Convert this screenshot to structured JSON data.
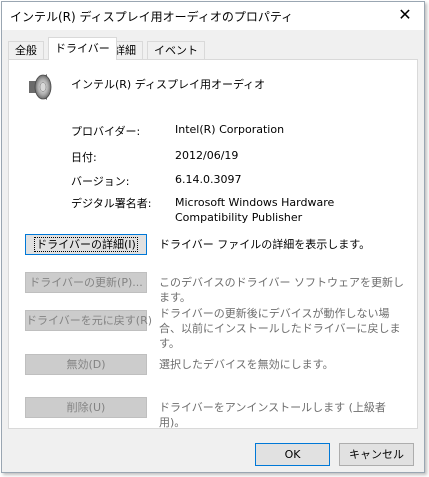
{
  "window": {
    "title": "インテル(R) ディスプレイ用オーディオのプロパティ"
  },
  "tabs": [
    "全般",
    "ドライバー",
    "詳細",
    "イベント"
  ],
  "device": {
    "name": "インテル(R) ディスプレイ用オーディオ",
    "icon": "speaker-icon"
  },
  "info": [
    {
      "label": "プロバイダー:",
      "value": "Intel(R) Corporation"
    },
    {
      "label": "日付:",
      "value": "2012/06/19"
    },
    {
      "label": "バージョン:",
      "value": "6.14.0.3097"
    },
    {
      "label": "デジタル署名者:",
      "value": "Microsoft Windows Hardware Compatibility Publisher"
    }
  ],
  "actions": [
    {
      "button": "ドライバーの詳細(I)",
      "description": "ドライバー ファイルの詳細を表示します。",
      "enabled": true
    },
    {
      "button": "ドライバーの更新(P)...",
      "description": "このデバイスのドライバー ソフトウェアを更新します。",
      "enabled": false
    },
    {
      "button": "ドライバーを元に戻す(R)",
      "description": "ドライバーの更新後にデバイスが動作しない場合、以前にインストールしたドライバーに戻します。",
      "enabled": false
    },
    {
      "button": "無効(D)",
      "description": "選択したデバイスを無効にします。",
      "enabled": false
    },
    {
      "button": "削除(U)",
      "description": "ドライバーをアンインストールします (上級者用)。",
      "enabled": false
    }
  ],
  "footer": {
    "ok": "OK",
    "cancel": "キャンセル"
  },
  "colors": {
    "accent": "#0078d7",
    "dialog_bg": "#f0f0f0",
    "panel_bg": "#ffffff",
    "disabled_text": "#838383"
  }
}
